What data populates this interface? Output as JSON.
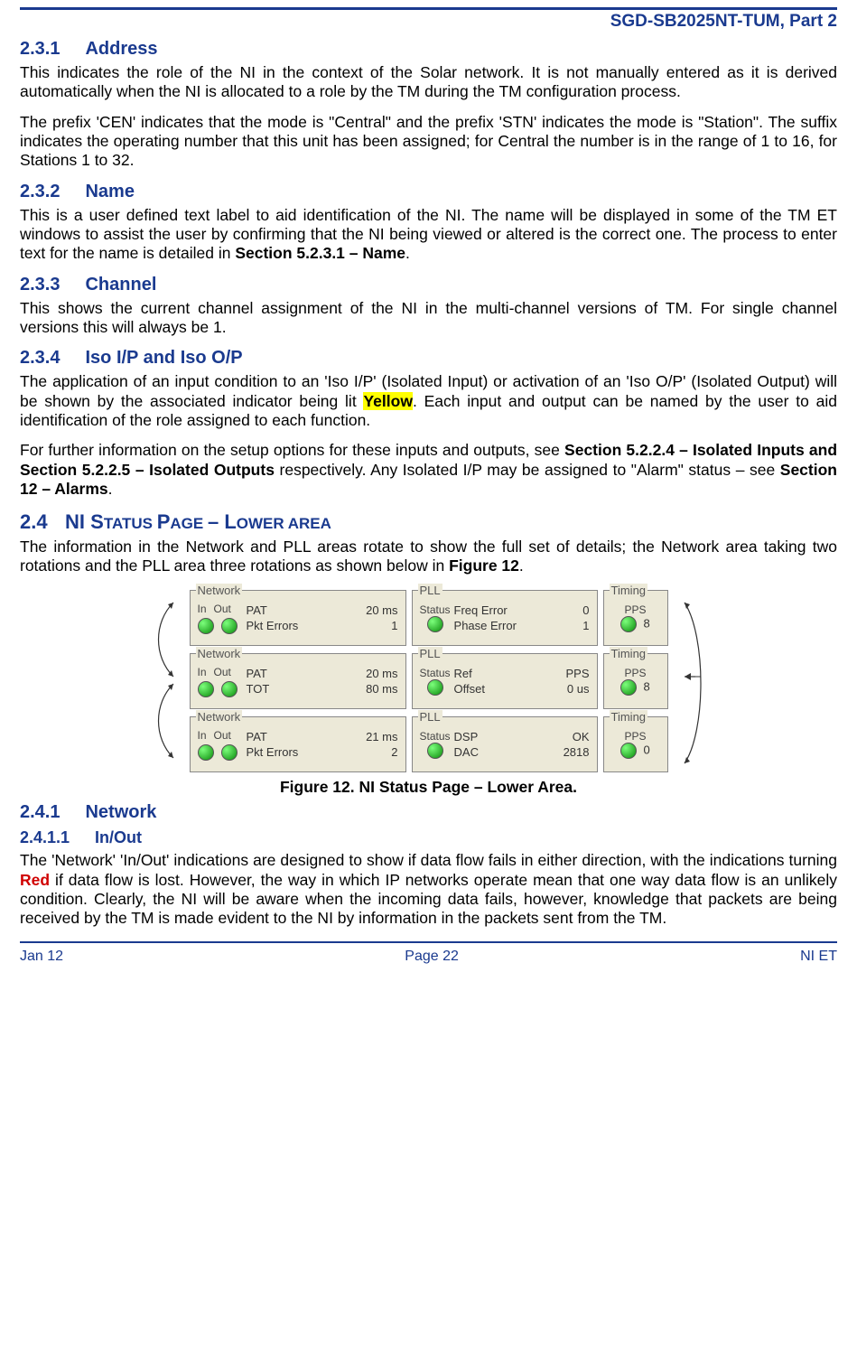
{
  "doc_header": "SGD-SB2025NT-TUM, Part 2",
  "s231": {
    "num": "2.3.1",
    "title": "Address",
    "p1": "This indicates the role of the NI in the context of the Solar network.  It is not manually entered as it is derived automatically when the NI is allocated to a role by the TM during the TM configuration process.",
    "p2": "The prefix 'CEN' indicates that the mode is \"Central\" and the prefix 'STN' indicates the mode is \"Station\".  The suffix indicates the operating number that this unit has been assigned; for Central the number is in the range of 1 to 16, for Stations 1 to 32."
  },
  "s232": {
    "num": "2.3.2",
    "title": "Name",
    "p1a": "This is a user defined text label to aid identification of the NI.  The name will be displayed in some of the TM ET windows to assist the user by confirming that the NI being viewed or altered is the correct one.  The process to enter text for the name is detailed in ",
    "p1b": "Section 5.2.3.1 – Name",
    "p1c": "."
  },
  "s233": {
    "num": "2.3.3",
    "title": "Channel",
    "p1": "This shows the current channel assignment of the NI in the multi-channel versions of TM.  For single channel versions this will always be 1."
  },
  "s234": {
    "num": "2.3.4",
    "title": "Iso I/P and Iso O/P",
    "p1a": "The application of an input condition to an 'Iso I/P' (Isolated Input) or activation of an 'Iso O/P' (Isolated Output) will be shown by the associated indicator being lit ",
    "p1y": "Yellow",
    "p1b": ".  Each input and output can be named by the user to aid identification of the role assigned to each function.",
    "p2a": "For further information on the setup options for these inputs and outputs, see ",
    "p2b": "Section 5.2.2.4 – Isolated Inputs and Section 5.2.2.5 – Isolated Outputs",
    "p2c": " respectively.  Any Isolated I/P may be assigned to \"Alarm\" status – see ",
    "p2d": "Section 12 – Alarms",
    "p2e": "."
  },
  "s24": {
    "num": "2.4",
    "title_a": "NI S",
    "title_b": "TATUS ",
    "title_c": "P",
    "title_d": "AGE ",
    "title_e": "– L",
    "title_f": "OWER AREA",
    "p1a": "The information in the Network and PLL areas rotate to show the full set of details; the Network area taking two rotations and the PLL area three rotations as shown below in ",
    "p1b": "Figure 12",
    "p1c": "."
  },
  "fig": {
    "caption": "Figure 12.  NI Status Page – Lower Area.",
    "labels": {
      "network": "Network",
      "in": "In",
      "out": "Out",
      "pll": "PLL",
      "status": "Status",
      "timing": "Timing",
      "pps": "PPS"
    },
    "rows": [
      {
        "net": [
          {
            "k": "PAT",
            "v": "20 ms"
          },
          {
            "k": "Pkt Errors",
            "v": "1"
          }
        ],
        "pll": [
          {
            "k": "Freq Error",
            "v": "0"
          },
          {
            "k": "Phase Error",
            "v": "1"
          }
        ],
        "tim": "8"
      },
      {
        "net": [
          {
            "k": "PAT",
            "v": "20 ms"
          },
          {
            "k": "TOT",
            "v": "80 ms"
          }
        ],
        "pll": [
          {
            "k": "Ref",
            "v": "PPS"
          },
          {
            "k": "Offset",
            "v": "0 us"
          }
        ],
        "tim": "8"
      },
      {
        "net": [
          {
            "k": "PAT",
            "v": "21 ms"
          },
          {
            "k": "Pkt Errors",
            "v": "2"
          }
        ],
        "pll": [
          {
            "k": "DSP",
            "v": "OK"
          },
          {
            "k": "DAC",
            "v": "2818"
          }
        ],
        "tim": "0"
      }
    ]
  },
  "s241": {
    "num": "2.4.1",
    "title": "Network"
  },
  "s2411": {
    "num": "2.4.1.1",
    "title": "In/Out",
    "p1a": "The 'Network' 'In/Out' indications are designed to show if data flow fails in either direction, with the indications turning ",
    "p1r": "Red",
    "p1b": " if data flow is lost.  However, the way in which IP networks operate mean that one way data flow is an unlikely condition.  Clearly, the NI will be aware when the incoming data fails, however, knowledge that packets are being received by the TM is made evident to the NI by information in the packets sent from the TM."
  },
  "footer": {
    "left": "Jan 12",
    "center": "Page 22",
    "right": "NI ET"
  }
}
